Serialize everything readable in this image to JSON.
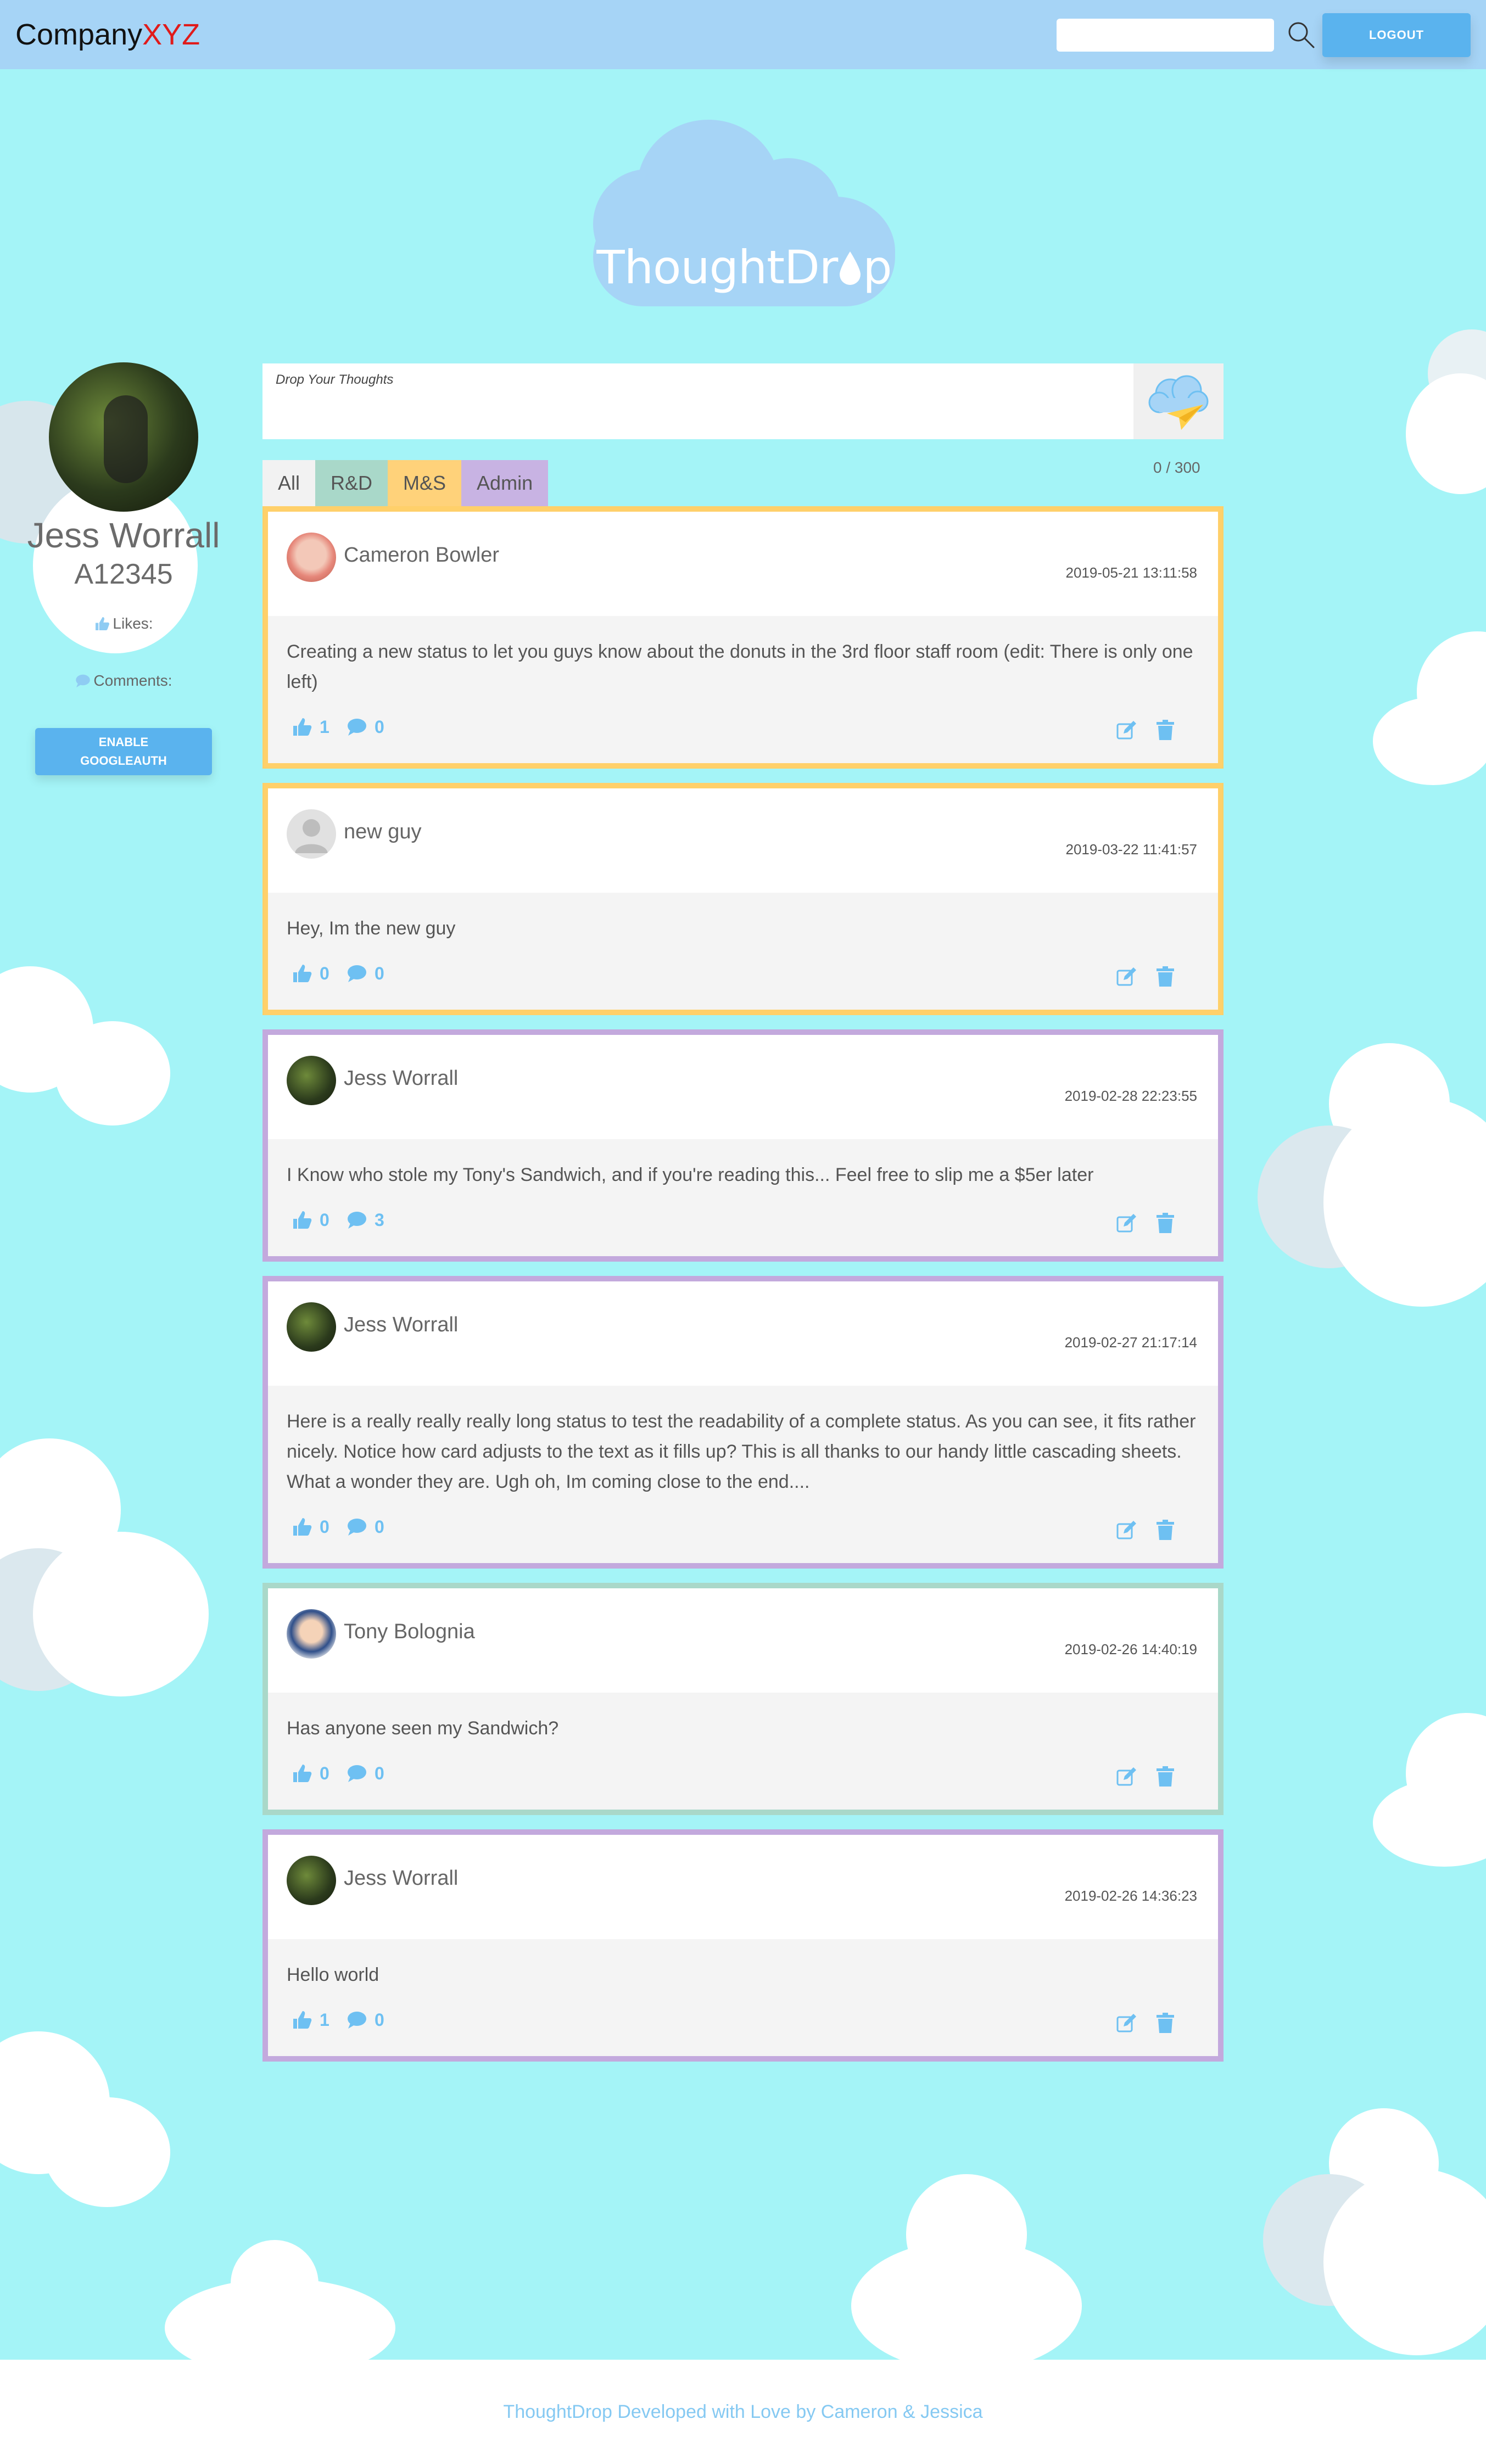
{
  "nav": {
    "brand_main": "Company",
    "brand_accent": "XYZ",
    "search_placeholder": "",
    "logout_label": "LOGOUT"
  },
  "logo": {
    "text_before": "ThoughtDr",
    "text_after": "p"
  },
  "profile": {
    "name": "Jess Worrall",
    "employee_id": "A12345",
    "likes_label": "Likes:",
    "comments_label": "Comments:",
    "googleauth_label": "ENABLE\nGOOGLEAUTH"
  },
  "composer": {
    "placeholder": "Drop Your Thoughts",
    "char_count": "0 / 300"
  },
  "tabs": [
    {
      "label": "All",
      "color": "#f2f2f2"
    },
    {
      "label": "R&D",
      "color": "#a9d8c9"
    },
    {
      "label": "M&S",
      "color": "#ffd27a"
    },
    {
      "label": "Admin",
      "color": "#c8b3e3"
    }
  ],
  "posts": [
    {
      "author": "Cameron Bowler",
      "date": "2019-05-21 13:11:58",
      "text": "Creating a new status to let you guys know about the donuts in the 3rd floor staff room (edit: There is only one left)",
      "likes": "1",
      "comments": "0",
      "border": "#ffd06a"
    },
    {
      "author": "new guy",
      "date": "2019-03-22 11:41:57",
      "text": "Hey, Im the new guy",
      "likes": "0",
      "comments": "0",
      "border": "#ffd06a"
    },
    {
      "author": "Jess Worrall",
      "date": "2019-02-28 22:23:55",
      "text": "I Know who stole my Tony's Sandwich, and if you're reading this... Feel free to slip me a $5er later",
      "likes": "0",
      "comments": "3",
      "border": "#c3a9dd"
    },
    {
      "author": "Jess Worrall",
      "date": "2019-02-27 21:17:14",
      "text": "Here is a really really really long status to test the readability of a complete status. As you can see, it fits rather nicely. Notice how card adjusts to the text as it fills up? This is all thanks to our handy little cascading sheets. What a wonder they are. Ugh oh, Im coming close to the end....",
      "likes": "0",
      "comments": "0",
      "border": "#c3a9dd"
    },
    {
      "author": "Tony Bolognia",
      "date": "2019-02-26 14:40:19",
      "text": "Has anyone seen my Sandwich?",
      "likes": "0",
      "comments": "0",
      "border": "#a9d8c9"
    },
    {
      "author": "Jess Worrall",
      "date": "2019-02-26 14:36:23",
      "text": "Hello world",
      "likes": "1",
      "comments": "0",
      "border": "#c3a9dd"
    }
  ],
  "footer": {
    "text": "ThoughtDrop Developed with Love by Cameron & Jessica"
  },
  "colors": {
    "background": "#a4f4f7",
    "nav": "#a6d4f6",
    "accent": "#5ab3ee",
    "icon": "#6ec0f2"
  }
}
